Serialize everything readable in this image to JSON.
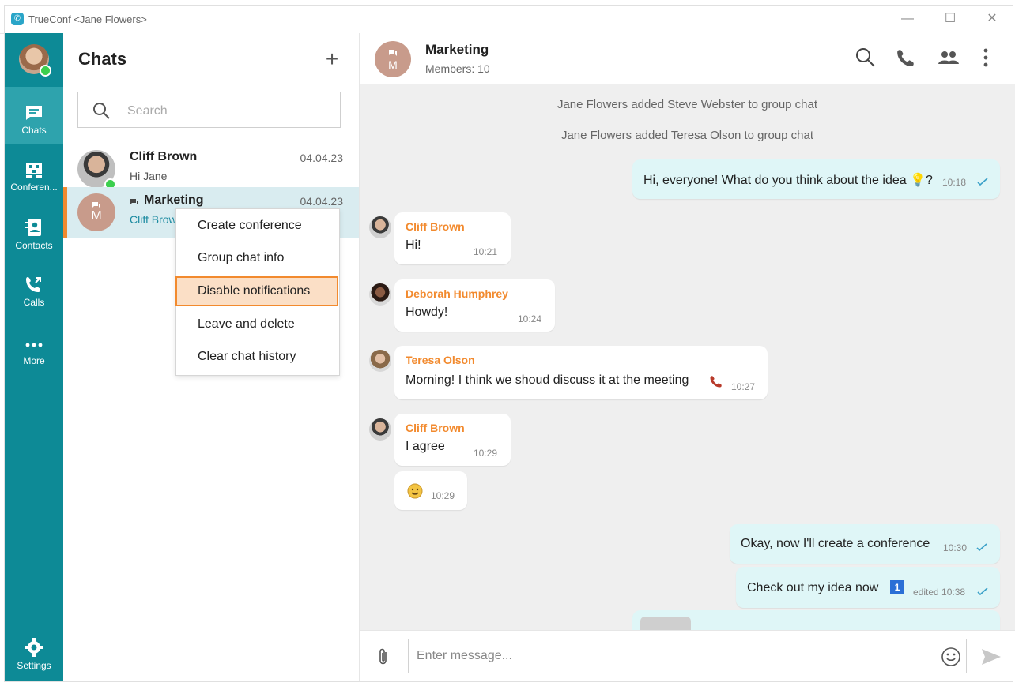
{
  "window": {
    "title": "TrueConf <Jane Flowers>",
    "controls": [
      "minimize-icon",
      "maximize-icon",
      "close-icon"
    ]
  },
  "nav": {
    "items": [
      {
        "label": "Chats",
        "icon": "chat-icon",
        "active": true
      },
      {
        "label": "Conferen...",
        "icon": "conference-icon"
      },
      {
        "label": "Contacts",
        "icon": "contacts-icon"
      },
      {
        "label": "Calls",
        "icon": "calls-icon"
      },
      {
        "label": "More",
        "icon": "more-dots-icon"
      }
    ],
    "settings_label": "Settings"
  },
  "chatlist": {
    "title": "Chats",
    "search_placeholder": "Search",
    "items": [
      {
        "name": "Cliff Brown",
        "date": "04.04.23",
        "preview": "Hi Jane"
      },
      {
        "name": "Marketing",
        "date": "04.04.23",
        "preview": "Cliff Brow",
        "avatar_letter": "M"
      }
    ]
  },
  "context_menu": {
    "items": [
      "Create conference",
      "Group chat info",
      "Disable notifications",
      "Leave and delete",
      "Clear chat history"
    ],
    "highlighted": "Disable notifications"
  },
  "chat": {
    "title": "Marketing",
    "subtitle": "Members: 10",
    "avatar_letter": "M",
    "system_messages": [
      "Jane Flowers added Steve Webster to group chat",
      "Jane Flowers added Teresa Olson to group chat"
    ],
    "messages": [
      {
        "direction": "out",
        "text": "Hi, everyone! What do you think about the idea",
        "suffix": "?",
        "time": "10:18"
      },
      {
        "direction": "in",
        "sender": "Cliff Brown",
        "text": "Hi!",
        "time": "10:21"
      },
      {
        "direction": "in",
        "sender": "Deborah Humphrey",
        "text": "Howdy!",
        "time": "10:24"
      },
      {
        "direction": "in",
        "sender": "Teresa Olson",
        "text": "Morning! I think we shoud discuss it at the meeting",
        "time": "10:27"
      },
      {
        "direction": "in",
        "sender": "Cliff Brown",
        "text": "I agree",
        "time": "10:29"
      },
      {
        "direction": "in",
        "text": "",
        "time": "10:29"
      },
      {
        "direction": "out",
        "text": "Okay, now I'll create a conference",
        "time": "10:30"
      },
      {
        "direction": "out",
        "text": "Check out my idea now",
        "time": "edited 10:38"
      }
    ],
    "composer_placeholder": "Enter message..."
  },
  "colors": {
    "sidebar": "#0d8a96",
    "accent": "#f28a2e",
    "outgoing_bubble": "#dff6f7",
    "selected_row": "#d9ecf0"
  }
}
